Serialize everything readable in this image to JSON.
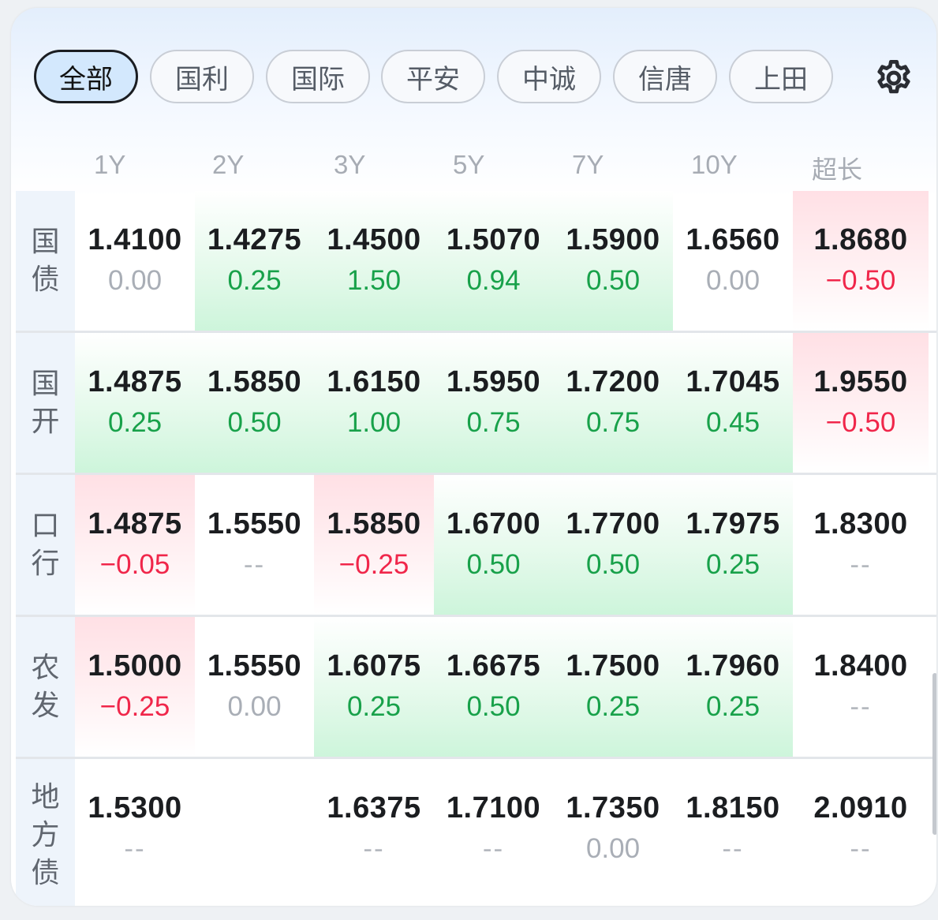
{
  "tabs": [
    {
      "label": "全部",
      "active": true
    },
    {
      "label": "国利",
      "active": false
    },
    {
      "label": "国际",
      "active": false
    },
    {
      "label": "平安",
      "active": false
    },
    {
      "label": "中诚",
      "active": false
    },
    {
      "label": "信唐",
      "active": false
    },
    {
      "label": "上田",
      "active": false
    }
  ],
  "settings_icon": "gear-icon",
  "columns": [
    "1Y",
    "2Y",
    "3Y",
    "5Y",
    "7Y",
    "10Y",
    "超长"
  ],
  "rows": [
    {
      "label": [
        "国",
        "债"
      ],
      "cells": [
        {
          "price": "1.4100",
          "change": "0.00",
          "trend": "flat"
        },
        {
          "price": "1.4275",
          "change": "0.25",
          "trend": "up"
        },
        {
          "price": "1.4500",
          "change": "1.50",
          "trend": "up"
        },
        {
          "price": "1.5070",
          "change": "0.94",
          "trend": "up"
        },
        {
          "price": "1.5900",
          "change": "0.50",
          "trend": "up"
        },
        {
          "price": "1.6560",
          "change": "0.00",
          "trend": "flat"
        },
        {
          "price": "1.8680",
          "change": "−0.50",
          "trend": "down"
        }
      ]
    },
    {
      "label": [
        "国",
        "开"
      ],
      "cells": [
        {
          "price": "1.4875",
          "change": "0.25",
          "trend": "up"
        },
        {
          "price": "1.5850",
          "change": "0.50",
          "trend": "up"
        },
        {
          "price": "1.6150",
          "change": "1.00",
          "trend": "up"
        },
        {
          "price": "1.5950",
          "change": "0.75",
          "trend": "up"
        },
        {
          "price": "1.7200",
          "change": "0.75",
          "trend": "up"
        },
        {
          "price": "1.7045",
          "change": "0.45",
          "trend": "up"
        },
        {
          "price": "1.9550",
          "change": "−0.50",
          "trend": "down"
        }
      ]
    },
    {
      "label": [
        "口",
        "行"
      ],
      "cells": [
        {
          "price": "1.4875",
          "change": "−0.05",
          "trend": "down"
        },
        {
          "price": "1.5550",
          "change": "--",
          "trend": "none"
        },
        {
          "price": "1.5850",
          "change": "−0.25",
          "trend": "down"
        },
        {
          "price": "1.6700",
          "change": "0.50",
          "trend": "up"
        },
        {
          "price": "1.7700",
          "change": "0.50",
          "trend": "up"
        },
        {
          "price": "1.7975",
          "change": "0.25",
          "trend": "up"
        },
        {
          "price": "1.8300",
          "change": "--",
          "trend": "none"
        }
      ]
    },
    {
      "label": [
        "农",
        "发"
      ],
      "cells": [
        {
          "price": "1.5000",
          "change": "−0.25",
          "trend": "down"
        },
        {
          "price": "1.5550",
          "change": "0.00",
          "trend": "flat"
        },
        {
          "price": "1.6075",
          "change": "0.25",
          "trend": "up"
        },
        {
          "price": "1.6675",
          "change": "0.50",
          "trend": "up"
        },
        {
          "price": "1.7500",
          "change": "0.25",
          "trend": "up"
        },
        {
          "price": "1.7960",
          "change": "0.25",
          "trend": "up"
        },
        {
          "price": "1.8400",
          "change": "--",
          "trend": "none"
        }
      ]
    },
    {
      "label": [
        "地",
        "方",
        "债"
      ],
      "cells": [
        {
          "price": "1.5300",
          "change": "--",
          "trend": "none"
        },
        {
          "price": "",
          "change": "",
          "trend": "empty"
        },
        {
          "price": "1.6375",
          "change": "--",
          "trend": "none"
        },
        {
          "price": "1.7100",
          "change": "--",
          "trend": "none"
        },
        {
          "price": "1.7350",
          "change": "0.00",
          "trend": "flat"
        },
        {
          "price": "1.8150",
          "change": "--",
          "trend": "none"
        },
        {
          "price": "2.0910",
          "change": "--",
          "trend": "none"
        }
      ]
    }
  ]
}
